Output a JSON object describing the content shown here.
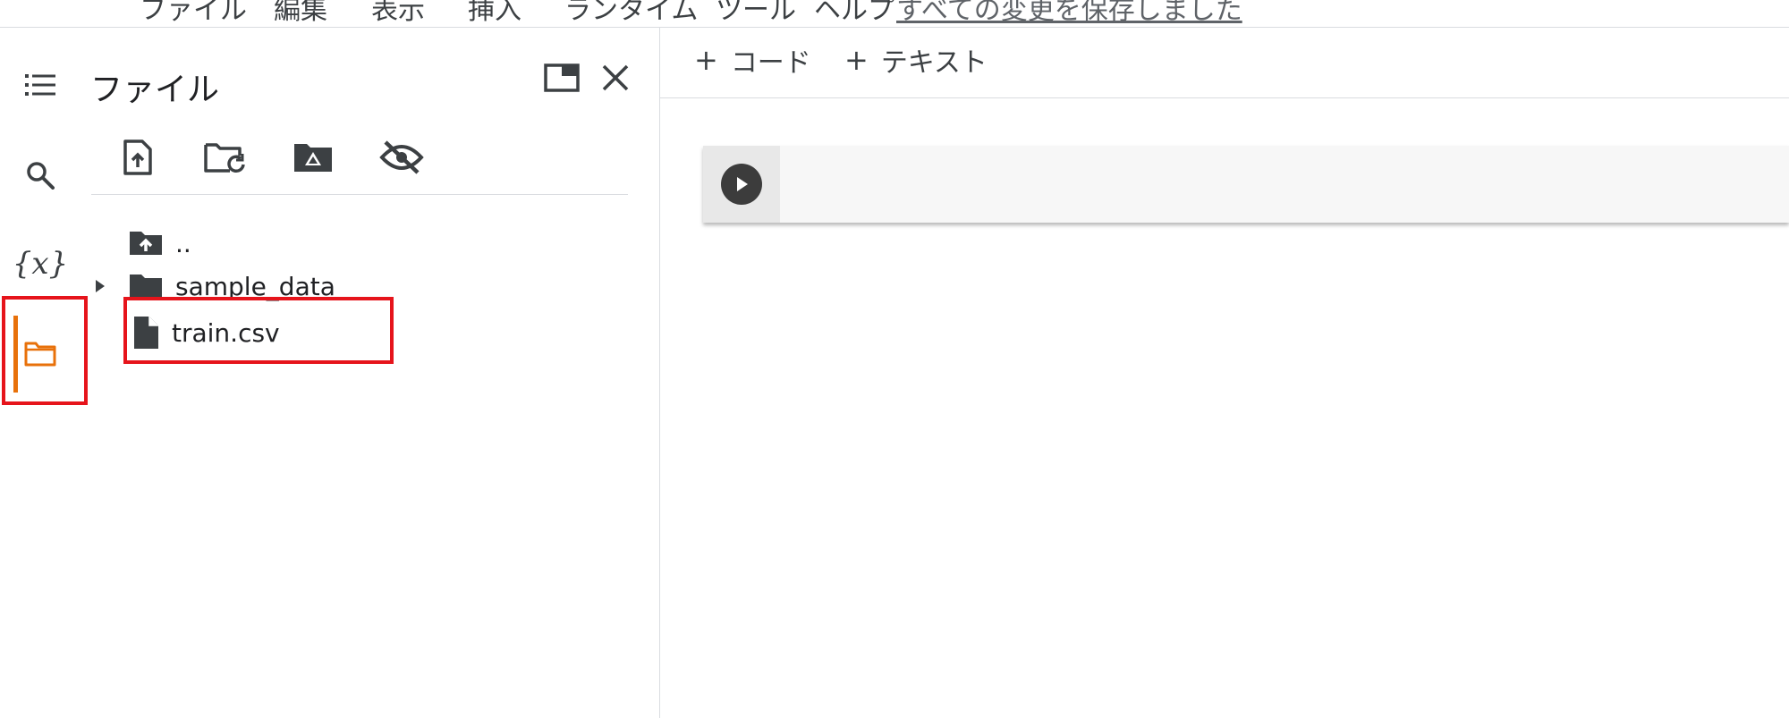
{
  "menubar": {
    "items": [
      "ファイル",
      "編集",
      "表示",
      "挿入",
      "ランタイム",
      "ツール",
      "ヘルプ"
    ],
    "save_status": "すべての変更を保存しました"
  },
  "rail": {
    "items": [
      {
        "icon": "table-of-contents-icon"
      },
      {
        "icon": "search-icon"
      },
      {
        "icon": "variables-icon",
        "glyph": "{x}"
      },
      {
        "icon": "folder-icon",
        "active": true
      }
    ],
    "active_color": "#e8710a",
    "highlight_color": "#e6141b"
  },
  "files_panel": {
    "title": "ファイル",
    "toolbar": [
      {
        "icon": "upload-file-icon"
      },
      {
        "icon": "refresh-folder-icon"
      },
      {
        "icon": "mount-drive-icon"
      },
      {
        "icon": "hide-hidden-files-icon"
      }
    ],
    "tree": [
      {
        "label": "..",
        "icon": "parent-folder-icon"
      },
      {
        "label": "sample_data",
        "icon": "folder-icon",
        "expandable": true
      },
      {
        "label": "train.csv",
        "icon": "file-icon",
        "highlighted": true
      }
    ]
  },
  "notebook": {
    "toolbar": {
      "add_code_plus": "+",
      "add_code_label": "コード",
      "add_text_plus": "+",
      "add_text_label": "テキスト"
    }
  }
}
